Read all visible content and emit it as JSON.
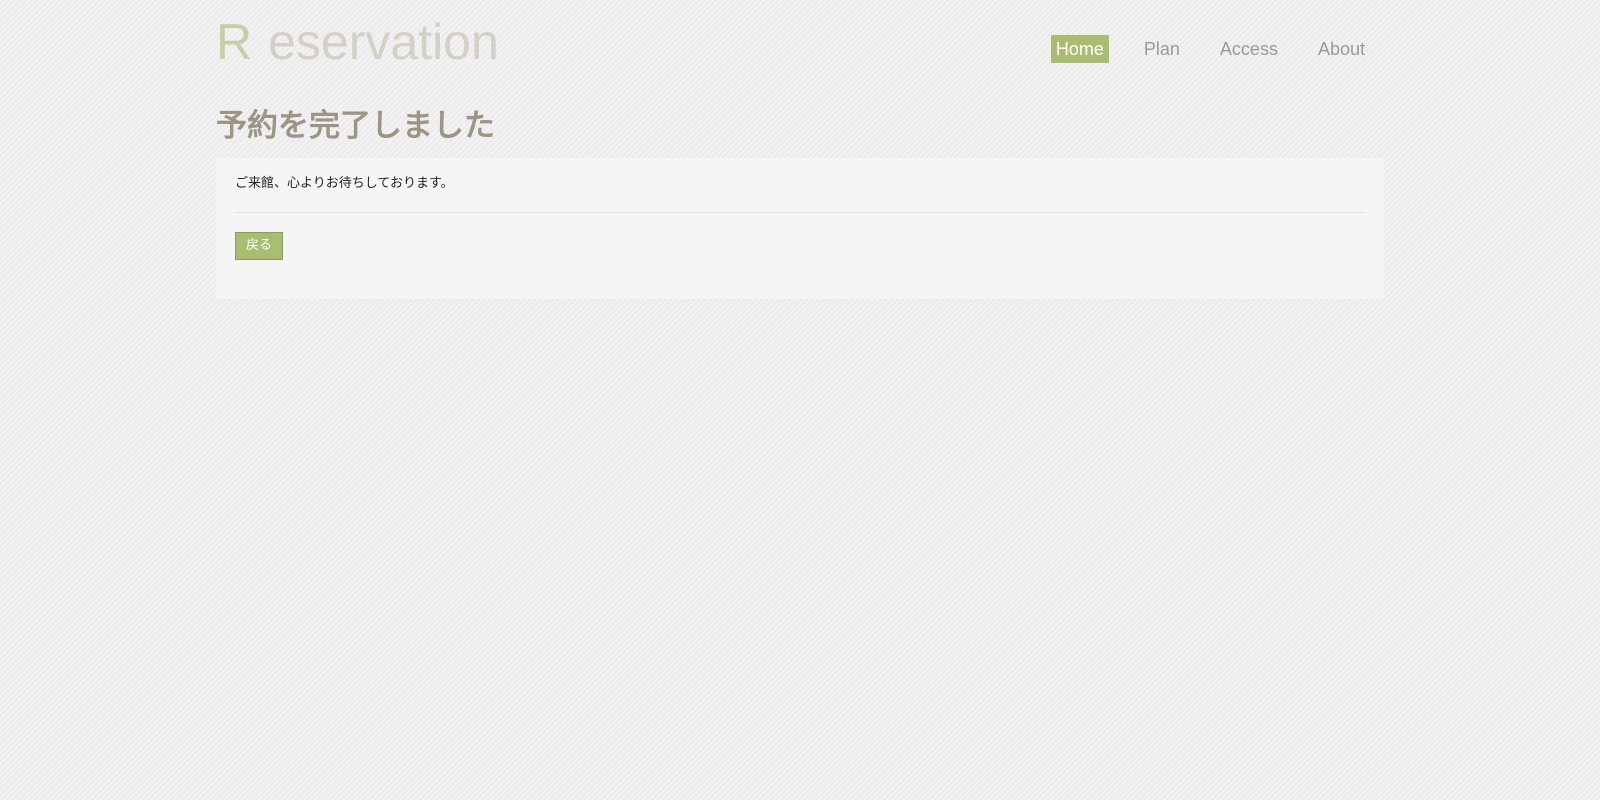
{
  "header": {
    "logo_initial": "R",
    "logo_rest": "eservation",
    "nav": [
      {
        "label": "Home",
        "active": true
      },
      {
        "label": "Plan",
        "active": false
      },
      {
        "label": "Access",
        "active": false
      },
      {
        "label": "About",
        "active": false
      }
    ]
  },
  "main": {
    "title": "予約を完了しました",
    "message": "ご来館、心よりお待ちしております。",
    "back_label": "戻る"
  },
  "colors": {
    "accent": "#a8bd72",
    "title": "#9c9484",
    "logo": "#d4d0c6",
    "logo_initial": "#c3cfa6",
    "nav_text": "#9a9a9a",
    "panel": "#f5f5f5"
  }
}
